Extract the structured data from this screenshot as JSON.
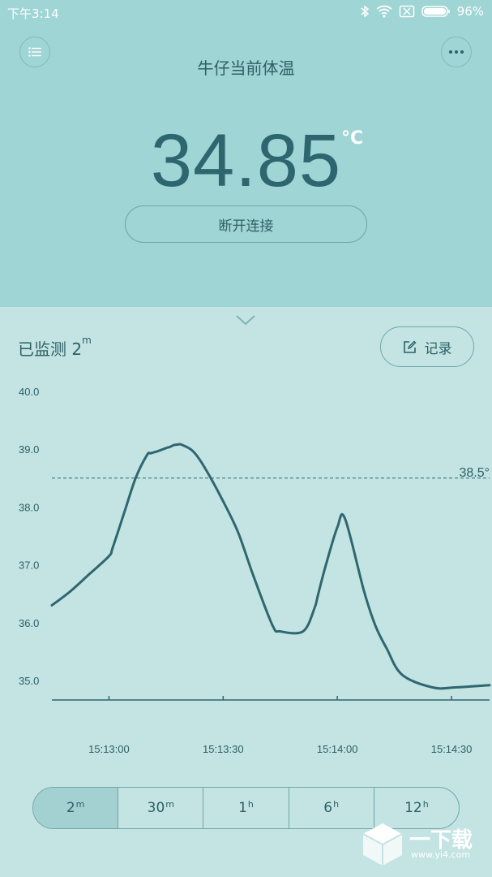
{
  "status_bar": {
    "time": "下午3:14",
    "battery_percent": "96%",
    "icons": [
      "bluetooth-icon",
      "wifi-icon",
      "sim-disabled-icon",
      "battery-icon"
    ]
  },
  "header": {
    "title": "牛仔当前体温",
    "temperature": "34.85",
    "unit": "°C",
    "disconnect_label": "断开连接"
  },
  "monitor": {
    "label": "已监测 2",
    "duration_unit": "m",
    "record_label": "记录"
  },
  "chart_data": {
    "type": "line",
    "y_ticks": [
      "40.0",
      "39.0",
      "38.0",
      "37.0",
      "36.0",
      "35.0"
    ],
    "ylim": [
      34.7,
      40.0
    ],
    "x_ticks": [
      "15:13:00",
      "15:13:30",
      "15:14:00",
      "15:14:30"
    ],
    "threshold": {
      "value": 38.5,
      "label": "38.5°"
    },
    "series": [
      {
        "x": [
          0,
          5,
          10,
          15,
          16,
          19,
          22,
          25,
          26,
          28,
          30,
          31,
          32,
          33,
          34,
          37,
          40,
          45,
          49,
          53,
          58,
          60,
          66,
          69,
          70,
          72,
          75,
          77,
          82,
          85,
          88,
          92,
          100,
          106,
          115
        ],
        "y": [
          36.3,
          36.55,
          36.85,
          37.15,
          37.3,
          37.9,
          38.5,
          38.9,
          38.93,
          38.97,
          39.02,
          39.04,
          39.07,
          39.08,
          39.08,
          38.97,
          38.7,
          38.1,
          37.55,
          36.8,
          35.95,
          35.85,
          35.85,
          36.25,
          36.5,
          37.0,
          37.65,
          37.8,
          36.55,
          35.95,
          35.55,
          35.1,
          34.88,
          34.88,
          34.92
        ]
      }
    ],
    "grid": false,
    "color": "#2f6670"
  },
  "ranges": [
    {
      "value": "2",
      "unit": "m",
      "active": true
    },
    {
      "value": "30",
      "unit": "m",
      "active": false
    },
    {
      "value": "1",
      "unit": "h",
      "active": false
    },
    {
      "value": "6",
      "unit": "h",
      "active": false
    },
    {
      "value": "12",
      "unit": "h",
      "active": false
    }
  ],
  "watermark": {
    "text": "一下载",
    "url": "www.yi4.com"
  },
  "colors": {
    "header_bg": "#9fd5d4",
    "body_bg": "#c3e4e3",
    "accent": "#2f6670",
    "border": "#6fa6a8"
  }
}
